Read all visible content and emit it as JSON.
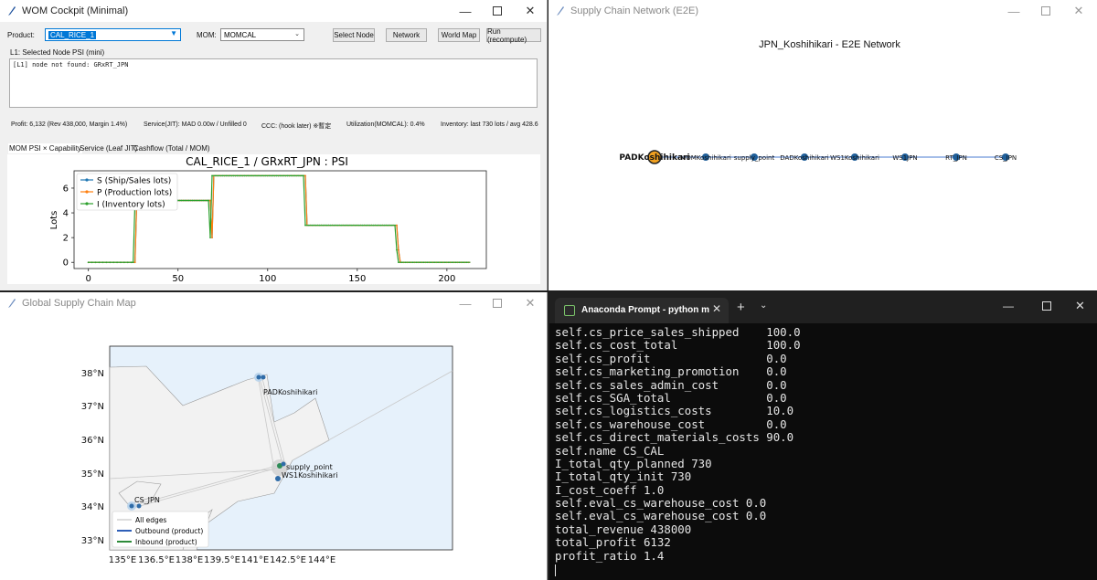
{
  "cockpit": {
    "title": "WOM Cockpit (Minimal)",
    "product_label": "Product:",
    "product_value": "CAL_RICE_1",
    "mom_label": "MOM:",
    "mom_value": "MOMCAL",
    "buttons": [
      "Select Node",
      "Network",
      "World Map",
      "Run (recompute)"
    ],
    "l1_label": "L1: Selected Node PSI (mini)",
    "l1_text": "[L1] node not found: GRxRT_JPN",
    "status": {
      "profit": "Profit: 6,132   (Rev 438,000, Margin 1.4%)",
      "service": "Service(JIT): MAD 0.00w / Unfilled 0",
      "ccc": "CCC: (hook later) ※暫定",
      "utilization": "Utilization(MOMCAL): 0.4%",
      "inventory": "Inventory: last 730 lots / avg 428.6"
    },
    "tabs": [
      "MOM PSI × Capability",
      "Service (Leaf JIT)",
      "Cashflow (Total / MOM)"
    ]
  },
  "chart_data": {
    "type": "line",
    "title": "CAL_RICE_1 / GRxRT_JPN : PSI",
    "xlabel": "",
    "ylabel": "Lots",
    "xlim": [
      -8,
      222
    ],
    "ylim": [
      -0.5,
      7.4
    ],
    "xticks": [
      0,
      50,
      100,
      150,
      200
    ],
    "yticks": [
      0,
      2,
      4,
      6
    ],
    "legend_position": "top-left",
    "series": [
      {
        "name": "S (Ship/Sales lots)",
        "color": "#1f77b4",
        "marker": "point",
        "points": [
          [
            0,
            0
          ],
          [
            26,
            0
          ],
          [
            27,
            5
          ],
          [
            68,
            5
          ],
          [
            69,
            2
          ],
          [
            70,
            7
          ],
          [
            121,
            7
          ],
          [
            122,
            3
          ],
          [
            172,
            3
          ],
          [
            173,
            1
          ],
          [
            174,
            0
          ],
          [
            213,
            0
          ]
        ]
      },
      {
        "name": "P (Production lots)",
        "color": "#ff7f0e",
        "marker": "point",
        "points": [
          [
            0,
            0
          ],
          [
            26,
            0
          ],
          [
            27,
            5
          ],
          [
            68,
            5
          ],
          [
            69,
            2
          ],
          [
            70,
            7
          ],
          [
            121,
            7
          ],
          [
            122,
            3
          ],
          [
            172,
            3
          ],
          [
            173,
            1
          ],
          [
            174,
            0
          ],
          [
            213,
            0
          ]
        ]
      },
      {
        "name": "I (Inventory lots)",
        "color": "#2ca02c",
        "marker": "point",
        "points": [
          [
            0,
            0
          ],
          [
            25,
            0
          ],
          [
            26,
            5
          ],
          [
            67,
            5
          ],
          [
            68,
            2
          ],
          [
            69,
            7
          ],
          [
            120,
            7
          ],
          [
            121,
            3
          ],
          [
            171,
            3
          ],
          [
            172,
            1
          ],
          [
            173,
            0
          ],
          [
            213,
            0
          ]
        ]
      }
    ]
  },
  "network": {
    "title": "Supply Chain Network (E2E)",
    "graph_title": "JPN_Koshihikari - E2E Network",
    "nodes": [
      "PADKoshihikari",
      "MOMKoshihikari",
      "supply_point",
      "DADKoshihikari",
      "WS1Koshihikari",
      "WS1JPN",
      "RT_JPN",
      "CS_JPN"
    ]
  },
  "map": {
    "title": "Global Supply Chain Map",
    "lat_ticks": [
      "38°N",
      "37°N",
      "36°N",
      "35°N",
      "34°N",
      "33°N"
    ],
    "lon_ticks": [
      "135°E",
      "136.5°E",
      "138°E",
      "139.5°E",
      "141°E",
      "142.5°E",
      "144°E"
    ],
    "labels": {
      "north": "PADKoshihikari",
      "center1": "supply_point",
      "center2": "WS1Koshihikari",
      "west": "CS_JPN"
    },
    "legend": [
      "All edges",
      "Outbound (product)",
      "Inbound (product)"
    ]
  },
  "terminal": {
    "tab_title": "Anaconda Prompt - python m",
    "lines": [
      "self.cs_price_sales_shipped    100.0",
      "self.cs_cost_total             100.0",
      "self.cs_profit                 0.0",
      "self.cs_marketing_promotion    0.0",
      "self.cs_sales_admin_cost       0.0",
      "self.cs_SGA_total              0.0",
      "self.cs_logistics_costs        10.0",
      "self.cs_warehouse_cost         0.0",
      "self.cs_direct_materials_costs 90.0",
      "self.name CS_CAL",
      "I_total_qty_planned 730",
      "I_total_qty_init 730",
      "I_cost_coeff 1.0",
      "self.eval_cs_warehouse_cost 0.0",
      "self.eval_cs_warehouse_cost 0.0",
      "total_revenue 438000",
      "total_profit 6132",
      "profit_ratio 1.4"
    ]
  }
}
